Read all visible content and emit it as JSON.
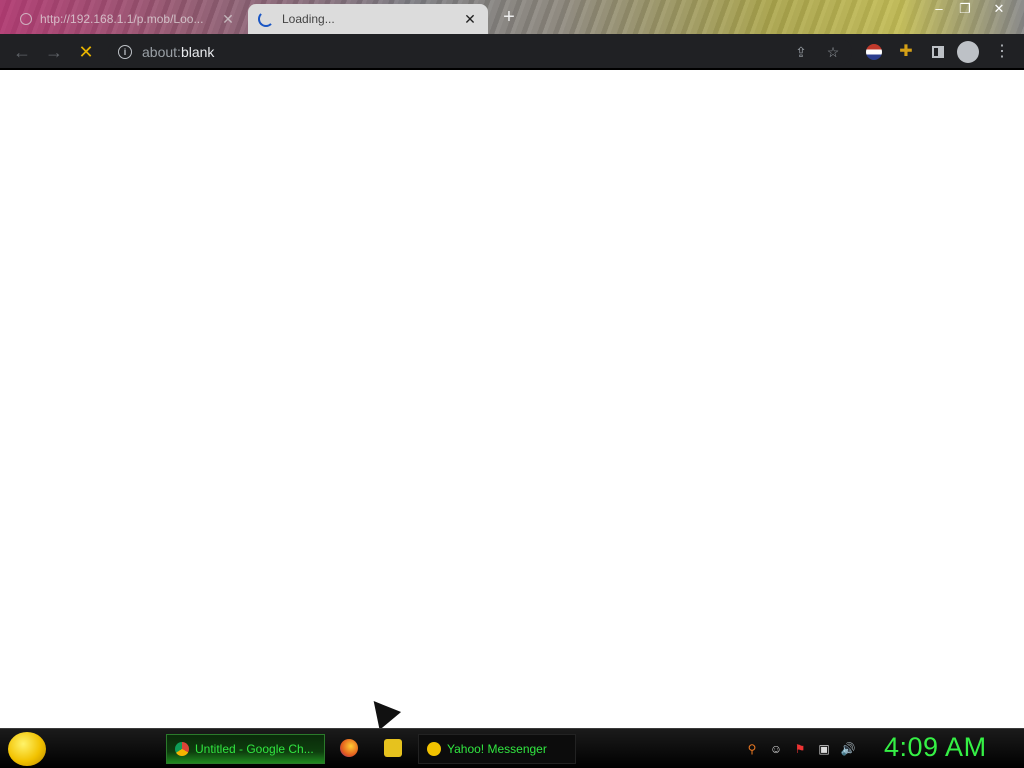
{
  "browser": {
    "tabs": [
      {
        "title": "http://192.168.1.1/p.mob/Loo...",
        "state": "inactive"
      },
      {
        "title": "Loading...",
        "state": "active"
      }
    ],
    "new_tab_symbol": "+",
    "window_controls": [
      "–",
      "❐",
      "✕"
    ],
    "nav": {
      "back": "←",
      "forward": "→",
      "stop": "✕"
    },
    "address": {
      "prefix": "about:",
      "host": "blank"
    },
    "omnibox_icons": [
      "share-icon",
      "bookmark-star-icon"
    ],
    "extensions": [
      "profile-flag-icon",
      "puzzle-extensions-icon",
      "side-panel-icon",
      "account-icon",
      "menu-kebab-icon"
    ]
  },
  "taskbar": {
    "tasks": [
      {
        "label": "Untitled - Google Ch...",
        "active": true
      },
      {
        "label": "Yahoo! Messenger",
        "active": false
      }
    ],
    "clock": "4:09 AM"
  },
  "colors": {
    "accent_green": "#35f045",
    "toolbar_bg": "#202124",
    "stop_button": "#e8b400"
  }
}
